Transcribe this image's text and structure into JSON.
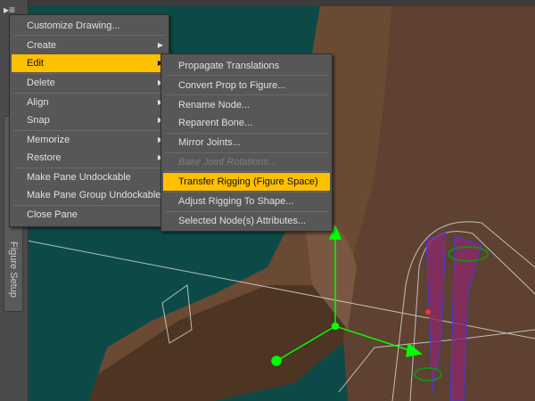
{
  "pane_tab": {
    "label": "Figure Setup",
    "menu_icon": "pane-menu-icon"
  },
  "main_menu": {
    "items": [
      {
        "label": "Customize Drawing..."
      },
      {
        "label": "Create",
        "submenu": true
      },
      {
        "label": "Edit",
        "submenu": true,
        "highlighted": true
      },
      {
        "label": "Delete",
        "submenu": true
      },
      {
        "label": "Align",
        "submenu": true
      },
      {
        "label": "Snap",
        "submenu": true
      },
      {
        "label": "Memorize",
        "submenu": true
      },
      {
        "label": "Restore",
        "submenu": true
      },
      {
        "label": "Make Pane Undockable"
      },
      {
        "label": "Make Pane Group Undockable"
      },
      {
        "label": "Close Pane"
      }
    ]
  },
  "edit_submenu": {
    "items": [
      {
        "label": "Propagate Translations"
      },
      {
        "label": "Convert Prop to Figure..."
      },
      {
        "label": "Rename Node..."
      },
      {
        "label": "Reparent Bone..."
      },
      {
        "label": "Mirror Joints..."
      },
      {
        "label": "Bake Joint Rotations...",
        "disabled": true
      },
      {
        "label": "Transfer Rigging (Figure Space)",
        "highlighted": true
      },
      {
        "label": "Adjust Rigging To Shape..."
      },
      {
        "label": "Selected Node(s) Attributes..."
      }
    ]
  },
  "colors": {
    "highlight": "#ffc000",
    "viewport": "#0d4a47",
    "menu": "#575757"
  }
}
